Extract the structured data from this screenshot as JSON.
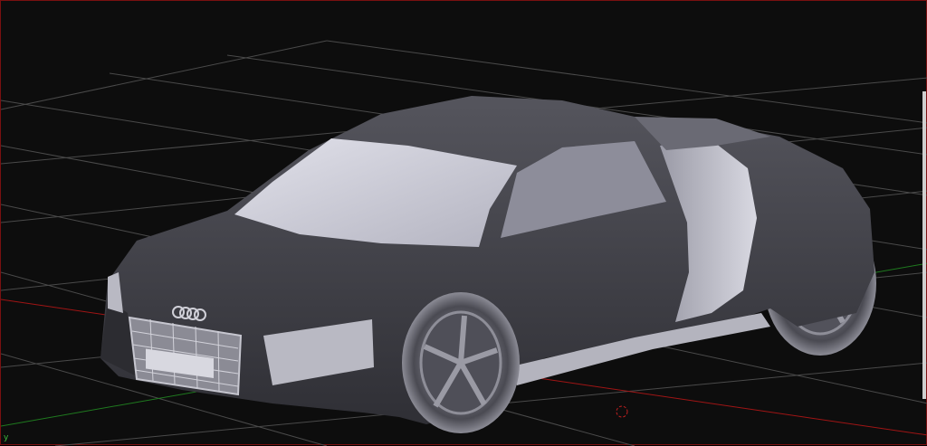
{
  "viewport": {
    "axis_label_y": "y",
    "colors": {
      "background": "#0d0d0d",
      "grid": "#4a4a4a",
      "x_axis": "#a01515",
      "y_axis": "#1f7a1f",
      "frame": "#7a1010",
      "body": "#3f3f45",
      "glass": "#c9c9d4",
      "trim": "#a9a9b3"
    }
  },
  "model": {
    "badge": "audi-rings-icon"
  }
}
